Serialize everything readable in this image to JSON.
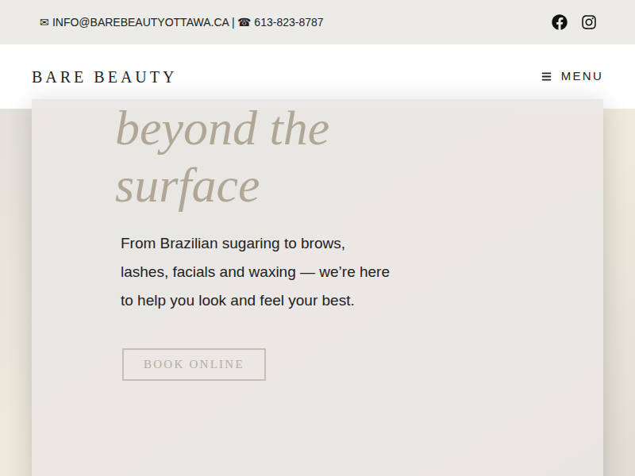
{
  "top_bar": {
    "contact": "✉ INFO@BAREBEAUTYOTTAWA.CA | ☎ 613-823-8787",
    "social": [
      "facebook",
      "instagram"
    ]
  },
  "header": {
    "logo": "BARE BEAUTY",
    "menu_label": "MENU"
  },
  "hero": {
    "heading_lines": [
      "beyond the",
      "surface"
    ],
    "text": "From Brazilian sugaring to brows, lashes, facials and waxing — we’re here to help you look and feel your best.",
    "button": "BOOK ONLINE"
  }
}
